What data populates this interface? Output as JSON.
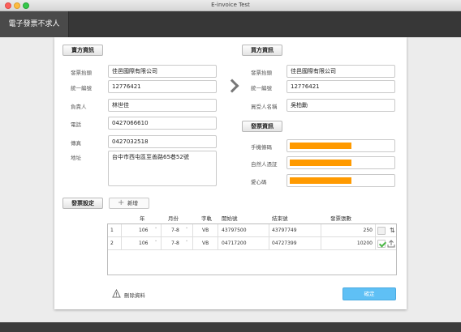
{
  "window": {
    "title": "E-invoice Test"
  },
  "nav": {
    "tab": "電子發票不求人"
  },
  "seller": {
    "section_label": "賣方資訊",
    "fields": [
      {
        "label": "發票抬頭",
        "value": "佳邑國際有限公司"
      },
      {
        "label": "統一編號",
        "value": "12776421"
      },
      {
        "label": "負責人",
        "value": "林世佳"
      },
      {
        "label": "電話",
        "value": "0427066610"
      },
      {
        "label": "傳真",
        "value": "0427032518"
      },
      {
        "label": "地址",
        "value": "台中市西屯區至善路65巷52號"
      }
    ]
  },
  "buyer": {
    "section_label": "買方資訊",
    "fields": [
      {
        "label": "發票抬頭",
        "value": "佳邑國際有限公司"
      },
      {
        "label": "統一編號",
        "value": "12776421"
      },
      {
        "label": "買受人名稱",
        "value": "吳柏勳"
      }
    ]
  },
  "invoice_info": {
    "section_label": "發票資訊",
    "fields": [
      {
        "label": "手機條碼",
        "value": ""
      },
      {
        "label": "自然人憑証",
        "value": ""
      },
      {
        "label": "愛心碼",
        "value": ""
      }
    ],
    "highlight_color": "#ff9a00"
  },
  "settings": {
    "section_label": "發票設定",
    "add_label": "新增",
    "columns": [
      "年",
      "月份",
      "字軌",
      "開始號",
      "結束號",
      "發票張數"
    ],
    "rows": [
      {
        "index": "1",
        "year": "106",
        "month": "7-8",
        "track": "VB",
        "start": "43797500",
        "end": "43797749",
        "count": "250",
        "checked": false,
        "action_icon": "sort-icon"
      },
      {
        "index": "2",
        "year": "106",
        "month": "7-8",
        "track": "VB",
        "start": "04717200",
        "end": "04727399",
        "count": "10200",
        "checked": true,
        "action_icon": "upload-icon"
      }
    ]
  },
  "footer": {
    "delete_label": "刪除資料",
    "confirm_label": "確定"
  },
  "colors": {
    "accent": "#5fc0f5",
    "checkmark": "#4db848"
  }
}
